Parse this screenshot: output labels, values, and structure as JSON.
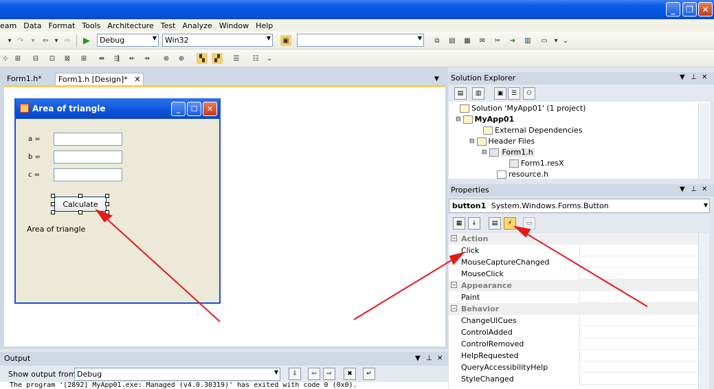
{
  "titlebar": {
    "minimize": "_",
    "restore": "❐",
    "close": "✕"
  },
  "menubar": {
    "items": [
      {
        "label": "eam"
      },
      {
        "label": "Data"
      },
      {
        "label": "Format"
      },
      {
        "label": "Tools"
      },
      {
        "label": "Architecture"
      },
      {
        "label": "Test"
      },
      {
        "label": "Analyze"
      },
      {
        "label": "Window"
      },
      {
        "label": "Help"
      }
    ]
  },
  "toolbar": {
    "config_value": "Debug",
    "platform_value": "Win32",
    "search_value": ""
  },
  "tabs": [
    {
      "label": "Form1.h*"
    },
    {
      "label": "Form1.h [Design]*"
    }
  ],
  "form": {
    "title": "Area of triangle",
    "labels": [
      "a =",
      "b =",
      "c ="
    ],
    "button_label": "Calculate",
    "result_label": "Area of triangle"
  },
  "solution_explorer": {
    "title": "Solution Explorer",
    "items": [
      {
        "label": "Solution 'MyApp01' (1 project)"
      },
      {
        "label": "MyApp01"
      },
      {
        "label": "External Dependencies"
      },
      {
        "label": "Header Files"
      },
      {
        "label": "Form1.h"
      },
      {
        "label": "Form1.resX"
      },
      {
        "label": "resource.h"
      }
    ]
  },
  "properties": {
    "title": "Properties",
    "object_name": "button1",
    "object_type": "System.Windows.Forms.Button",
    "rows": [
      {
        "name": "Action",
        "category": true
      },
      {
        "name": "Click",
        "category": false
      },
      {
        "name": "MouseCaptureChanged",
        "category": false
      },
      {
        "name": "MouseClick",
        "category": false
      },
      {
        "name": "Appearance",
        "category": true
      },
      {
        "name": "Paint",
        "category": false
      },
      {
        "name": "Behavior",
        "category": true
      },
      {
        "name": "ChangeUICues",
        "category": false
      },
      {
        "name": "ControlAdded",
        "category": false
      },
      {
        "name": "ControlRemoved",
        "category": false
      },
      {
        "name": "HelpRequested",
        "category": false
      },
      {
        "name": "QueryAccessibilityHelp",
        "category": false
      },
      {
        "name": "StyleChanged",
        "category": false
      }
    ]
  },
  "output": {
    "title": "Output",
    "show_from_label": "Show output from:",
    "show_from_value": "Debug",
    "text": "The program '[2892] MyApp01.exe: Managed (v4.0.30319)' has exited with code 0 (0x0)."
  },
  "colors": {
    "titlebar": "#0454e0",
    "arrow": "#e81818",
    "designer_border": "#f5cf5a"
  }
}
